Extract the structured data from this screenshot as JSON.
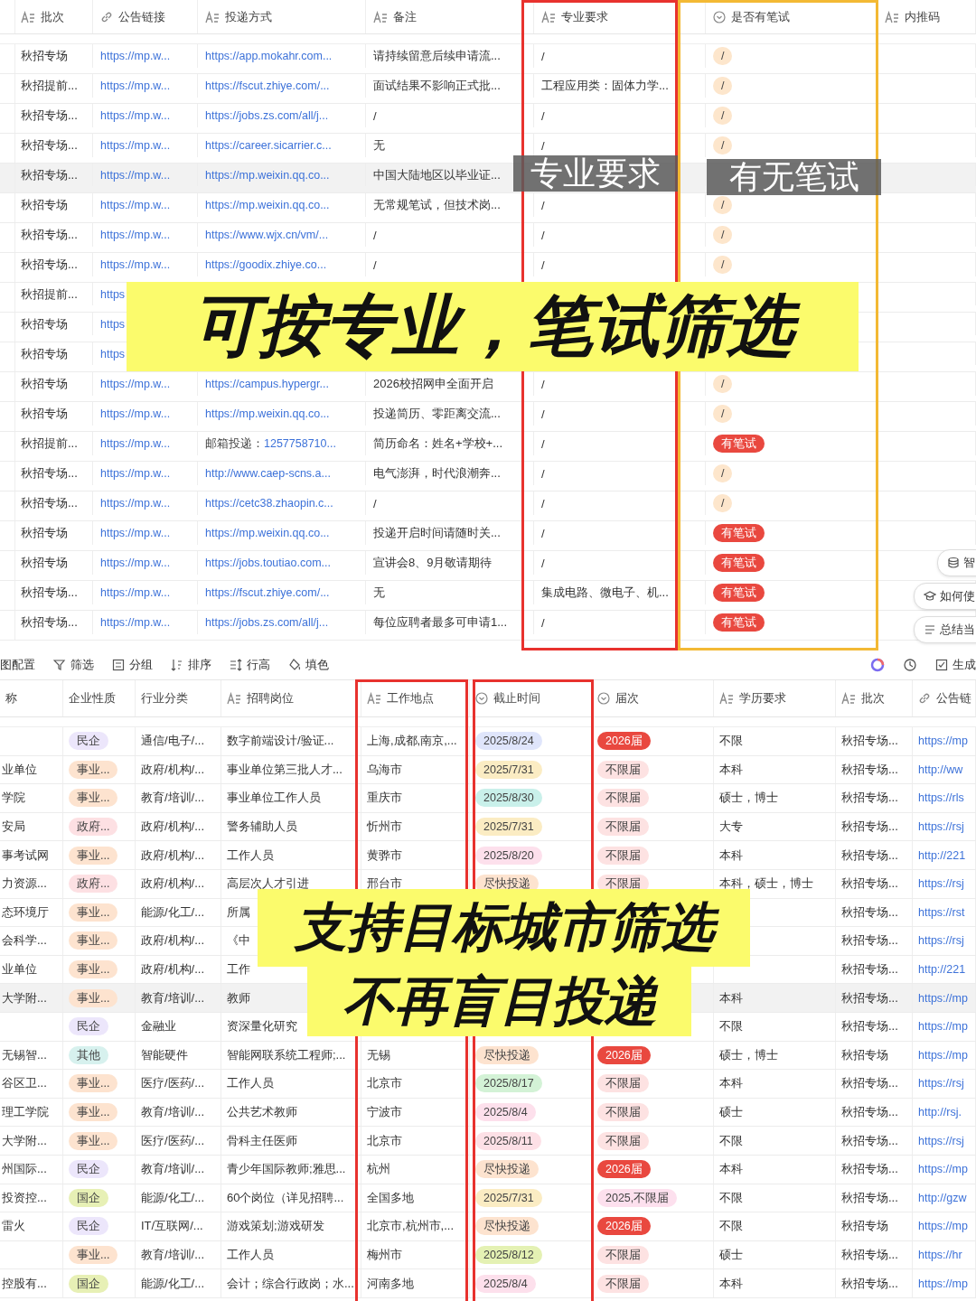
{
  "top_table": {
    "columns": [
      {
        "label": "批次",
        "kind": "text"
      },
      {
        "label": "公告链接",
        "kind": "link"
      },
      {
        "label": "投递方式",
        "kind": "text"
      },
      {
        "label": "备注",
        "kind": "text"
      },
      {
        "label": "专业要求",
        "kind": "text"
      },
      {
        "label": "是否有笔试",
        "kind": "option"
      },
      {
        "label": "内推码",
        "kind": "text"
      }
    ],
    "rows": [
      {
        "highlighted": false,
        "cells": [
          "秋招专场",
          {
            "kind": "link",
            "text": "https://mp.w..."
          },
          {
            "kind": "link",
            "text": "https://app.mokahr.com..."
          },
          "请持续留意后续申请流...",
          "/",
          {
            "kind": "tag",
            "text": "/",
            "color": "#fde6cc"
          }
        ]
      },
      {
        "highlighted": false,
        "cells": [
          "秋招提前...",
          {
            "kind": "link",
            "text": "https://mp.w..."
          },
          {
            "kind": "link",
            "text": "https://fscut.zhiye.com/..."
          },
          "面试结果不影响正式批...",
          "工程应用类：固体力学...",
          {
            "kind": "tag",
            "text": "/",
            "color": "#fde6cc"
          }
        ]
      },
      {
        "highlighted": false,
        "cells": [
          "秋招专场...",
          {
            "kind": "link",
            "text": "https://mp.w..."
          },
          {
            "kind": "link",
            "text": "https://jobs.zs.com/all/j..."
          },
          "/",
          "/",
          {
            "kind": "tag",
            "text": "/",
            "color": "#fde6cc"
          }
        ]
      },
      {
        "highlighted": false,
        "cells": [
          "秋招专场...",
          {
            "kind": "link",
            "text": "https://mp.w..."
          },
          {
            "kind": "link",
            "text": "https://career.sicarrier.c..."
          },
          "无",
          "/",
          {
            "kind": "tag",
            "text": "/",
            "color": "#fde6cc"
          }
        ]
      },
      {
        "highlighted": true,
        "cells": [
          "秋招专场...",
          {
            "kind": "link",
            "text": "https://mp.w..."
          },
          {
            "kind": "link",
            "text": "https://mp.weixin.qq.co..."
          },
          "中国大陆地区以毕业证...",
          null,
          null
        ]
      },
      {
        "highlighted": false,
        "cells": [
          "秋招专场",
          {
            "kind": "link",
            "text": "https://mp.w..."
          },
          {
            "kind": "link",
            "text": "https://mp.weixin.qq.co..."
          },
          "无常规笔试，但技术岗...",
          "/",
          {
            "kind": "tag",
            "text": "/",
            "color": "#fde6cc"
          }
        ]
      },
      {
        "highlighted": false,
        "cells": [
          "秋招专场...",
          {
            "kind": "link",
            "text": "https://mp.w..."
          },
          {
            "kind": "link",
            "text": "https://www.wjx.cn/vm/..."
          },
          "/",
          "/",
          {
            "kind": "tag",
            "text": "/",
            "color": "#fde6cc"
          }
        ]
      },
      {
        "highlighted": false,
        "cells": [
          "秋招专场...",
          {
            "kind": "link",
            "text": "https://mp.w..."
          },
          {
            "kind": "link",
            "text": "https://goodix.zhiye.co..."
          },
          "/",
          "/",
          {
            "kind": "tag",
            "text": "/",
            "color": "#fde6cc"
          }
        ]
      },
      {
        "highlighted": false,
        "cells": [
          "秋招提前...",
          {
            "kind": "link",
            "text": "https"
          },
          null,
          null,
          null,
          null
        ]
      },
      {
        "highlighted": false,
        "cells": [
          "秋招专场",
          {
            "kind": "link",
            "text": "https"
          },
          null,
          null,
          null,
          null
        ]
      },
      {
        "highlighted": false,
        "cells": [
          "秋招专场",
          {
            "kind": "link",
            "text": "https"
          },
          null,
          null,
          null,
          null
        ]
      },
      {
        "highlighted": false,
        "cells": [
          "秋招专场",
          {
            "kind": "link",
            "text": "https://mp.w..."
          },
          {
            "kind": "link",
            "text": "https://campus.hypergr..."
          },
          "2026校招网申全面开启",
          "/",
          {
            "kind": "tag",
            "text": "/",
            "color": "#fde6cc"
          }
        ]
      },
      {
        "highlighted": false,
        "cells": [
          "秋招专场",
          {
            "kind": "link",
            "text": "https://mp.w..."
          },
          {
            "kind": "link",
            "text": "https://mp.weixin.qq.co..."
          },
          "投递简历、零距离交流...",
          "/",
          {
            "kind": "tag",
            "text": "/",
            "color": "#fde6cc"
          }
        ]
      },
      {
        "highlighted": false,
        "cells": [
          "秋招提前...",
          {
            "kind": "link",
            "text": "https://mp.w..."
          },
          {
            "kind": "mail",
            "text": "邮箱投递：",
            "link": "1257758710..."
          },
          "简历命名：姓名+学校+...",
          "/",
          {
            "kind": "tag",
            "text": "有笔试",
            "color": "#e9483f"
          }
        ]
      },
      {
        "highlighted": false,
        "cells": [
          "秋招专场...",
          {
            "kind": "link",
            "text": "https://mp.w..."
          },
          {
            "kind": "link",
            "text": "http://www.caep-scns.a..."
          },
          "电气澎湃，时代浪潮奔...",
          "/",
          {
            "kind": "tag",
            "text": "/",
            "color": "#fde6cc"
          }
        ]
      },
      {
        "highlighted": false,
        "cells": [
          "秋招专场...",
          {
            "kind": "link",
            "text": "https://mp.w..."
          },
          {
            "kind": "link",
            "text": "https://cetc38.zhaopin.c..."
          },
          "/",
          "/",
          {
            "kind": "tag",
            "text": "/",
            "color": "#fde6cc"
          }
        ]
      },
      {
        "highlighted": false,
        "cells": [
          "秋招专场",
          {
            "kind": "link",
            "text": "https://mp.w..."
          },
          {
            "kind": "link",
            "text": "https://mp.weixin.qq.co..."
          },
          "投递开启时间请随时关...",
          "/",
          {
            "kind": "tag",
            "text": "有笔试",
            "color": "#e9483f"
          }
        ]
      },
      {
        "highlighted": false,
        "cells": [
          "秋招专场",
          {
            "kind": "link",
            "text": "https://mp.w..."
          },
          {
            "kind": "link",
            "text": "https://jobs.toutiao.com..."
          },
          "宣讲会8、9月敬请期待",
          "/",
          {
            "kind": "tag",
            "text": "有笔试",
            "color": "#e9483f"
          }
        ]
      },
      {
        "highlighted": false,
        "cells": [
          "秋招专场...",
          {
            "kind": "link",
            "text": "https://mp.w..."
          },
          {
            "kind": "link",
            "text": "https://fscut.zhiye.com/..."
          },
          "无",
          "集成电路、微电子、机...",
          {
            "kind": "tag",
            "text": "有笔试",
            "color": "#e9483f"
          }
        ]
      },
      {
        "highlighted": false,
        "cells": [
          "秋招专场...",
          {
            "kind": "link",
            "text": "https://mp.w..."
          },
          {
            "kind": "link",
            "text": "https://jobs.zs.com/all/j..."
          },
          "每位应聘者最多可申请1...",
          "/",
          {
            "kind": "tag",
            "text": "有笔试",
            "color": "#e9483f"
          }
        ]
      }
    ],
    "overlays": [
      {
        "kind": "label",
        "text": "专业要求"
      },
      {
        "kind": "label",
        "text": "有无笔试"
      },
      {
        "kind": "banner",
        "text": "可按专业，笔试筛选"
      }
    ],
    "assist_buttons": [
      {
        "label": "智",
        "kind": "database"
      },
      {
        "label": "如何使",
        "kind": "cap"
      },
      {
        "label": "总结当",
        "kind": "list"
      }
    ]
  },
  "bottom_table": {
    "toolbar": [
      {
        "label": "图配置",
        "kind": "plain"
      },
      {
        "label": "筛选",
        "kind": "filter"
      },
      {
        "label": "分组",
        "kind": "group"
      },
      {
        "label": "排序",
        "kind": "sort"
      },
      {
        "label": "行高",
        "kind": "height"
      },
      {
        "label": "填色",
        "kind": "fill"
      }
    ],
    "toolbar_right": [
      {
        "label": "生成",
        "kind": "check"
      }
    ],
    "columns": [
      {
        "label": "称",
        "kind": "plain"
      },
      {
        "label": "企业性质",
        "kind": "plain"
      },
      {
        "label": "行业分类",
        "kind": "plain"
      },
      {
        "label": "招聘岗位",
        "kind": "text"
      },
      {
        "label": "工作地点",
        "kind": "text"
      },
      {
        "label": "截止时间",
        "kind": "option"
      },
      {
        "label": "届次",
        "kind": "option"
      },
      {
        "label": "学历要求",
        "kind": "text"
      },
      {
        "label": "批次",
        "kind": "text"
      },
      {
        "label": "公告链",
        "kind": "link"
      }
    ],
    "rows": [
      {
        "highlighted": false,
        "cells": [
          null,
          {
            "kind": "tag",
            "text": "民企",
            "color": "#ece6fb"
          },
          "通信/电子/...",
          "数字前端设计/验证...",
          "上海,成都,南京,...",
          {
            "kind": "tag",
            "text": "2025/8/24",
            "color": "#dfe5fb"
          },
          {
            "kind": "tag",
            "text": "2026届",
            "color": "#e9483f"
          },
          "不限",
          "秋招专场...",
          {
            "kind": "link",
            "text": "https://mp"
          }
        ]
      },
      {
        "highlighted": false,
        "cells": [
          "业单位",
          {
            "kind": "tag",
            "text": "事业...",
            "color": "#fde3cf"
          },
          "政府/机构/...",
          "事业单位第三批人才...",
          "乌海市",
          {
            "kind": "tag",
            "text": "2025/7/31",
            "color": "#fbecc3"
          },
          {
            "kind": "tag",
            "text": "不限届",
            "color": "#fde2e2"
          },
          "本科",
          "秋招专场...",
          {
            "kind": "link",
            "text": "http://ww"
          }
        ]
      },
      {
        "highlighted": false,
        "cells": [
          "学院",
          {
            "kind": "tag",
            "text": "事业...",
            "color": "#fde3cf"
          },
          "教育/培训/...",
          "事业单位工作人员",
          "重庆市",
          {
            "kind": "tag",
            "text": "2025/8/30",
            "color": "#c9f0ea"
          },
          {
            "kind": "tag",
            "text": "不限届",
            "color": "#fde2e2"
          },
          "硕士，博士",
          "秋招专场...",
          {
            "kind": "link",
            "text": "https://rls"
          }
        ]
      },
      {
        "highlighted": false,
        "cells": [
          "安局",
          {
            "kind": "tag",
            "text": "政府...",
            "color": "#fde0e3"
          },
          "政府/机构/...",
          "警务辅助人员",
          "忻州市",
          {
            "kind": "tag",
            "text": "2025/7/31",
            "color": "#fbecc3"
          },
          {
            "kind": "tag",
            "text": "不限届",
            "color": "#fde2e2"
          },
          "大专",
          "秋招专场...",
          {
            "kind": "link",
            "text": "https://rsj"
          }
        ]
      },
      {
        "highlighted": false,
        "cells": [
          "事考试网",
          {
            "kind": "tag",
            "text": "事业...",
            "color": "#fde3cf"
          },
          "政府/机构/...",
          "工作人员",
          "黄骅市",
          {
            "kind": "tag",
            "text": "2025/8/20",
            "color": "#fde0ec"
          },
          {
            "kind": "tag",
            "text": "不限届",
            "color": "#fde2e2"
          },
          "本科",
          "秋招专场...",
          {
            "kind": "link",
            "text": "http://221"
          }
        ]
      },
      {
        "highlighted": false,
        "cells": [
          "力资源...",
          {
            "kind": "tag",
            "text": "政府...",
            "color": "#fde0e3"
          },
          "政府/机构/...",
          "高层次人才引进",
          "邢台市",
          {
            "kind": "tag",
            "text": "尽快投递",
            "color": "#fde3cf"
          },
          {
            "kind": "tag",
            "text": "不限届",
            "color": "#fde2e2"
          },
          "本科，硕士，博士",
          "秋招专场...",
          {
            "kind": "link",
            "text": "https://rsj"
          }
        ]
      },
      {
        "highlighted": false,
        "cells": [
          "态环境厅",
          {
            "kind": "tag",
            "text": "事业...",
            "color": "#fde3cf"
          },
          "能源/化工/...",
          "所属",
          null,
          null,
          null,
          null,
          "秋招专场...",
          {
            "kind": "link",
            "text": "https://rst"
          }
        ]
      },
      {
        "highlighted": false,
        "cells": [
          "会科学...",
          {
            "kind": "tag",
            "text": "事业...",
            "color": "#fde3cf"
          },
          "政府/机构/...",
          "《中",
          null,
          null,
          null,
          null,
          "秋招专场...",
          {
            "kind": "link",
            "text": "https://rsj"
          }
        ]
      },
      {
        "highlighted": false,
        "cells": [
          "业单位",
          {
            "kind": "tag",
            "text": "事业...",
            "color": "#fde3cf"
          },
          "政府/机构/...",
          "工作",
          null,
          null,
          null,
          null,
          "秋招专场...",
          {
            "kind": "link",
            "text": "http://221"
          }
        ]
      },
      {
        "highlighted": true,
        "cells": [
          "大学附...",
          {
            "kind": "tag",
            "text": "事业...",
            "color": "#fde3cf"
          },
          "教育/培训/...",
          "教师",
          null,
          null,
          null,
          "本科",
          "秋招专场...",
          {
            "kind": "link",
            "text": "https://mp"
          }
        ]
      },
      {
        "highlighted": false,
        "cells": [
          null,
          {
            "kind": "tag",
            "text": "民企",
            "color": "#ece6fb"
          },
          "金融业",
          "资深量化研究",
          null,
          null,
          null,
          "不限",
          "秋招专场...",
          {
            "kind": "link",
            "text": "https://mp"
          }
        ]
      },
      {
        "highlighted": false,
        "cells": [
          "无锡智...",
          {
            "kind": "tag",
            "text": "其他",
            "color": "#d7f1ee"
          },
          "智能硬件",
          "智能网联系统工程师;...",
          "无锡",
          {
            "kind": "tag",
            "text": "尽快投递",
            "color": "#fde3cf"
          },
          {
            "kind": "tag",
            "text": "2026届",
            "color": "#e9483f"
          },
          "硕士，博士",
          "秋招专场",
          {
            "kind": "link",
            "text": "https://mp"
          }
        ]
      },
      {
        "highlighted": false,
        "cells": [
          "谷区卫...",
          {
            "kind": "tag",
            "text": "事业...",
            "color": "#fde3cf"
          },
          "医疗/医药/...",
          "工作人员",
          "北京市",
          {
            "kind": "tag",
            "text": "2025/8/17",
            "color": "#d3f2d6"
          },
          {
            "kind": "tag",
            "text": "不限届",
            "color": "#fde2e2"
          },
          "本科",
          "秋招专场...",
          {
            "kind": "link",
            "text": "https://rsj"
          }
        ]
      },
      {
        "highlighted": false,
        "cells": [
          "理工学院",
          {
            "kind": "tag",
            "text": "事业...",
            "color": "#fde3cf"
          },
          "教育/培训/...",
          "公共艺术教师",
          "宁波市",
          {
            "kind": "tag",
            "text": "2025/8/4",
            "color": "#fde0ec"
          },
          {
            "kind": "tag",
            "text": "不限届",
            "color": "#fde2e2"
          },
          "硕士",
          "秋招专场...",
          {
            "kind": "link",
            "text": "http://rsj."
          }
        ]
      },
      {
        "highlighted": false,
        "cells": [
          "大学附...",
          {
            "kind": "tag",
            "text": "事业...",
            "color": "#fde3cf"
          },
          "医疗/医药/...",
          "骨科主任医师",
          "北京市",
          {
            "kind": "tag",
            "text": "2025/8/11",
            "color": "#fde0e6"
          },
          {
            "kind": "tag",
            "text": "不限届",
            "color": "#fde2e2"
          },
          "不限",
          "秋招专场...",
          {
            "kind": "link",
            "text": "https://rsj"
          }
        ]
      },
      {
        "highlighted": false,
        "cells": [
          "州国际...",
          {
            "kind": "tag",
            "text": "民企",
            "color": "#ece6fb"
          },
          "教育/培训/...",
          "青少年国际教师;雅思...",
          "杭州",
          {
            "kind": "tag",
            "text": "尽快投递",
            "color": "#fde3cf"
          },
          {
            "kind": "tag",
            "text": "2026届",
            "color": "#e9483f"
          },
          "本科",
          "秋招专场...",
          {
            "kind": "link",
            "text": "https://mp"
          }
        ]
      },
      {
        "highlighted": false,
        "cells": [
          "投资控...",
          {
            "kind": "tag",
            "text": "国企",
            "color": "#e7f0b5"
          },
          "能源/化工/...",
          "60个岗位（详见招聘...",
          "全国多地",
          {
            "kind": "tag",
            "text": "2025/7/31",
            "color": "#fbecc3"
          },
          {
            "kind": "tag",
            "text": "2025,不限届",
            "color": "#fde0ee"
          },
          "不限",
          "秋招专场...",
          {
            "kind": "link",
            "text": "http://gzw"
          }
        ]
      },
      {
        "highlighted": false,
        "cells": [
          "雷火",
          {
            "kind": "tag",
            "text": "民企",
            "color": "#ece6fb"
          },
          "IT/互联网/...",
          "游戏策划;游戏研发",
          "北京市,杭州市,...",
          {
            "kind": "tag",
            "text": "尽快投递",
            "color": "#fde3cf"
          },
          {
            "kind": "tag",
            "text": "2026届",
            "color": "#e9483f"
          },
          "不限",
          "秋招专场",
          {
            "kind": "link",
            "text": "https://mp"
          }
        ]
      },
      {
        "highlighted": false,
        "cells": [
          null,
          {
            "kind": "tag",
            "text": "事业...",
            "color": "#fde3cf"
          },
          "教育/培训/...",
          "工作人员",
          "梅州市",
          {
            "kind": "tag",
            "text": "2025/8/12",
            "color": "#e4f1b3"
          },
          {
            "kind": "tag",
            "text": "不限届",
            "color": "#fde2e2"
          },
          "硕士",
          "秋招专场...",
          {
            "kind": "link",
            "text": "https://hr"
          }
        ]
      },
      {
        "highlighted": false,
        "cells": [
          "控股有...",
          {
            "kind": "tag",
            "text": "国企",
            "color": "#e7f0b5"
          },
          "能源/化工/...",
          "会计；综合行政岗；水...",
          "河南多地",
          {
            "kind": "tag",
            "text": "2025/8/4",
            "color": "#fde0ec"
          },
          {
            "kind": "tag",
            "text": "不限届",
            "color": "#fde2e2"
          },
          "本科",
          "秋招专场...",
          {
            "kind": "link",
            "text": "https://mp"
          }
        ]
      }
    ],
    "overlays": [
      {
        "kind": "banner",
        "text": "支持目标城市筛选"
      },
      {
        "kind": "banner",
        "text": "不再盲目投递"
      }
    ]
  }
}
